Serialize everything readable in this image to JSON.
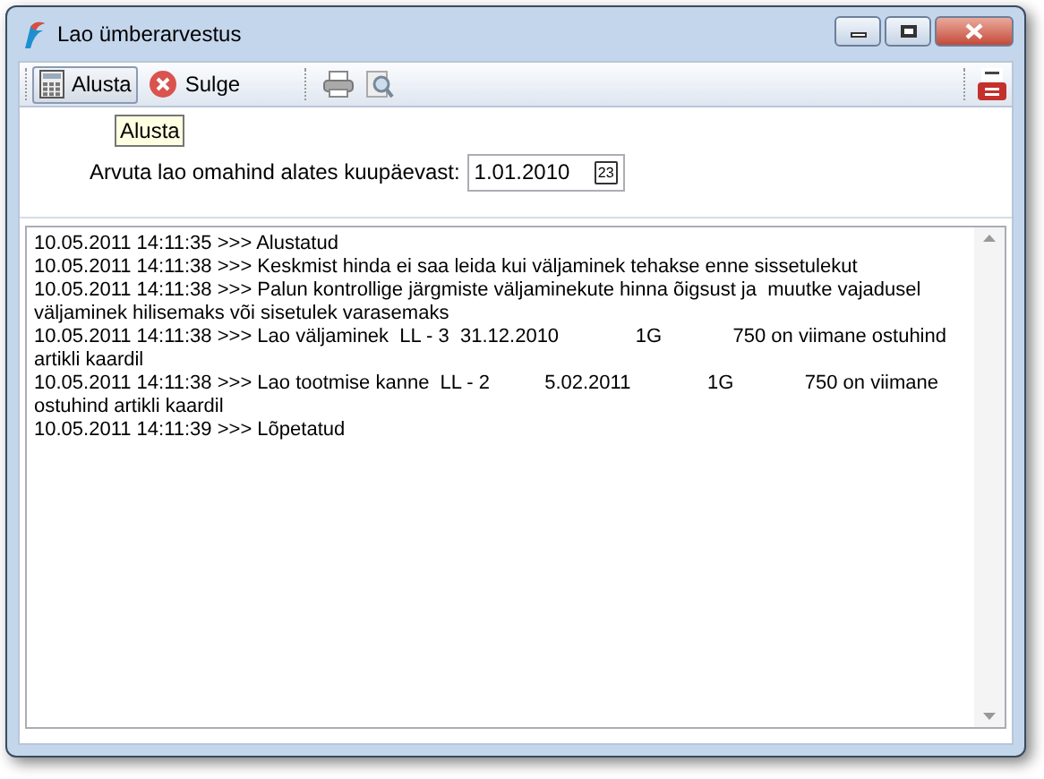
{
  "window": {
    "title": "Lao ümberarvestus",
    "controls": [
      {
        "kind": "minimize"
      },
      {
        "kind": "maximize"
      },
      {
        "kind": "close"
      }
    ]
  },
  "toolbar": {
    "buttons": [
      {
        "label": "Alusta",
        "kind": "calc",
        "hovered": true
      },
      {
        "label": "Sulge",
        "kind": "close",
        "hovered": false
      }
    ],
    "tooltip": "Alusta"
  },
  "form": {
    "label": "Arvuta lao omahind alates kuupäevast:",
    "date": "1.01.2010",
    "calendar_day": "23"
  },
  "log": [
    "10.05.2011 14:11:35 >>> Alustatud",
    "10.05.2011 14:11:38 >>> Keskmist hinda ei saa leida kui väljaminek tehakse enne sissetulekut",
    "10.05.2011 14:11:38 >>> Palun kontrollige järgmiste väljaminekute hinna õigsust ja  muutke vajadusel väljaminek hilisemaks või sisetulek varasemaks",
    "10.05.2011 14:11:38 >>> Lao väljaminek  LL - 3  31.12.2010              1G             750 on viimane ostuhind artikli kaardil",
    "10.05.2011 14:11:38 >>> Lao tootmise kanne  LL - 2          5.02.2011              1G             750 on viimane ostuhind artikli kaardil",
    "10.05.2011 14:11:39 >>> Lõpetatud"
  ]
}
